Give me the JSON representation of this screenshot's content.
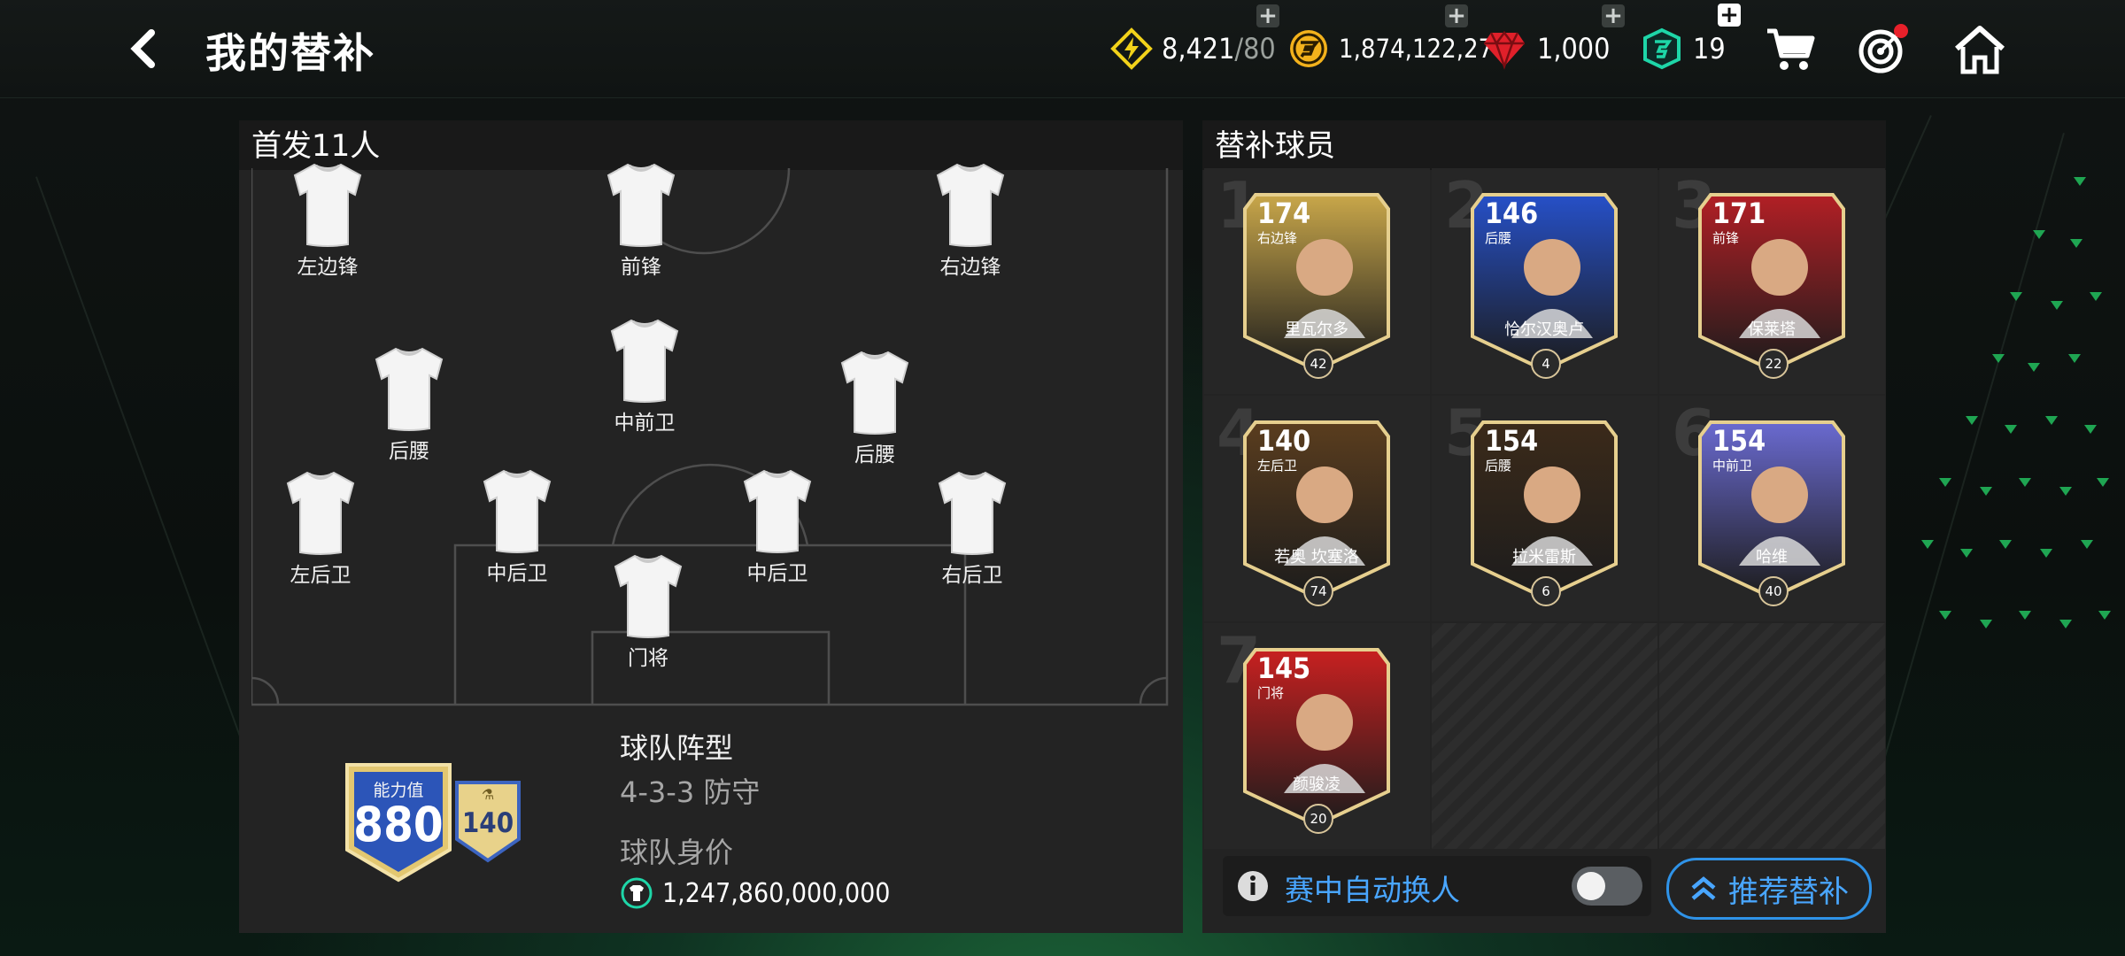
{
  "header": {
    "title": "我的替补",
    "energy": "8,421",
    "energy_max": "/80",
    "coins": "1,874,122,270",
    "gems": "1,000",
    "tokens": "19",
    "colors": {
      "energy": "#f2d21a",
      "coins": "#f3b21c",
      "gems": "#e0202a",
      "tokens": "#1ed6a8"
    }
  },
  "starting": {
    "title": "首发11人",
    "positions": {
      "lw": "左边锋",
      "st": "前锋",
      "rw": "右边锋",
      "cam": "中前卫",
      "lcm": "后腰",
      "rcm": "后腰",
      "lb": "左后卫",
      "lcb": "中后卫",
      "rcb": "中后卫",
      "rb": "右后卫",
      "gk": "门将"
    },
    "rating_label": "能力值",
    "rating": "880",
    "chem": "140",
    "formation_label": "球队阵型",
    "formation": "4-3-3 防守",
    "value_label": "球队身价",
    "value": "1,247,860,000,000"
  },
  "subs": {
    "title": "替补球员",
    "cards": [
      {
        "num": "1",
        "rating": "174",
        "pos": "右边锋",
        "name": "里瓦尔多",
        "level": "42",
        "color": "#c9a74a"
      },
      {
        "num": "2",
        "rating": "146",
        "pos": "后腰",
        "name": "恰尔汉奥卢",
        "level": "4",
        "color": "#2650c8"
      },
      {
        "num": "3",
        "rating": "171",
        "pos": "前锋",
        "name": "保莱塔",
        "level": "22",
        "color": "#b21f25"
      },
      {
        "num": "4",
        "rating": "140",
        "pos": "左后卫",
        "name": "若奥 坎塞洛",
        "level": "74",
        "color": "#5a3d1e"
      },
      {
        "num": "5",
        "rating": "154",
        "pos": "后腰",
        "name": "拉米雷斯",
        "level": "6",
        "color": "#3b2a1a"
      },
      {
        "num": "6",
        "rating": "154",
        "pos": "中前卫",
        "name": "哈维",
        "level": "40",
        "color": "#6a6ad0"
      },
      {
        "num": "7",
        "rating": "145",
        "pos": "门将",
        "name": "颜骏凌",
        "level": "20",
        "color": "#c82020"
      }
    ],
    "auto_sub_label": "赛中自动换人",
    "auto_sub_on": false,
    "recommend_label": "推荐替补"
  }
}
